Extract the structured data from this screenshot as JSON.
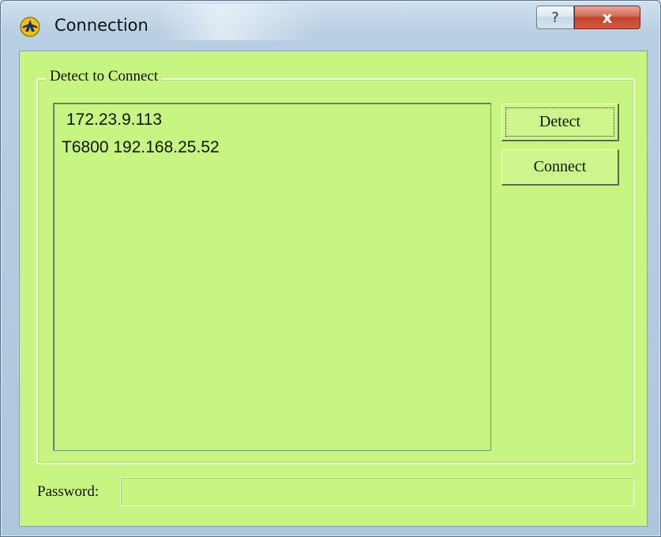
{
  "window": {
    "title": "Connection",
    "help_label": "?",
    "close_label": "x"
  },
  "group": {
    "label": "Detect to Connect"
  },
  "devices": [
    "172.23.9.113",
    "T6800 192.168.25.52"
  ],
  "buttons": {
    "detect": "Detect",
    "connect": "Connect"
  },
  "password": {
    "label": "Password:",
    "value": ""
  },
  "colors": {
    "client_background": "#c7f582",
    "close_button": "#c2412a",
    "frame": "#b9cfe3"
  },
  "icons": {
    "app": "app-logo-icon",
    "help": "help-icon",
    "close": "close-icon"
  }
}
